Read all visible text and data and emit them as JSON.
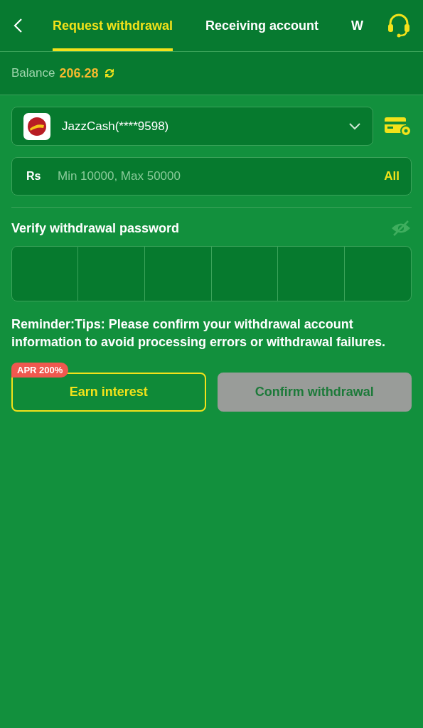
{
  "tabs": [
    {
      "label": "Request withdrawal",
      "selected": true
    },
    {
      "label": "Receiving account",
      "selected": false
    },
    {
      "label": "W",
      "selected": false
    }
  ],
  "balance": {
    "label": "Balance",
    "amount": "206.28"
  },
  "account": {
    "name": "JazzCash(****9598)"
  },
  "amount_field": {
    "currency": "Rs",
    "placeholder": "Min 10000, Max 50000",
    "all_label": "All"
  },
  "password": {
    "label": "Verify withdrawal password",
    "visible": false,
    "cells": [
      {
        "filled": false
      },
      {
        "filled": false
      },
      {
        "filled": false
      },
      {
        "filled": false
      },
      {
        "filled": false
      },
      {
        "filled": false
      }
    ]
  },
  "reminder": "Reminder:Tips: Please confirm your withdrawal account information to avoid processing errors or withdrawal failures.",
  "buttons": [
    {
      "label": "Earn interest",
      "badge": "APR 200%",
      "kind": "outline",
      "disabled": false
    },
    {
      "label": "Confirm withdrawal",
      "kind": "solid",
      "disabled": true
    }
  ]
}
